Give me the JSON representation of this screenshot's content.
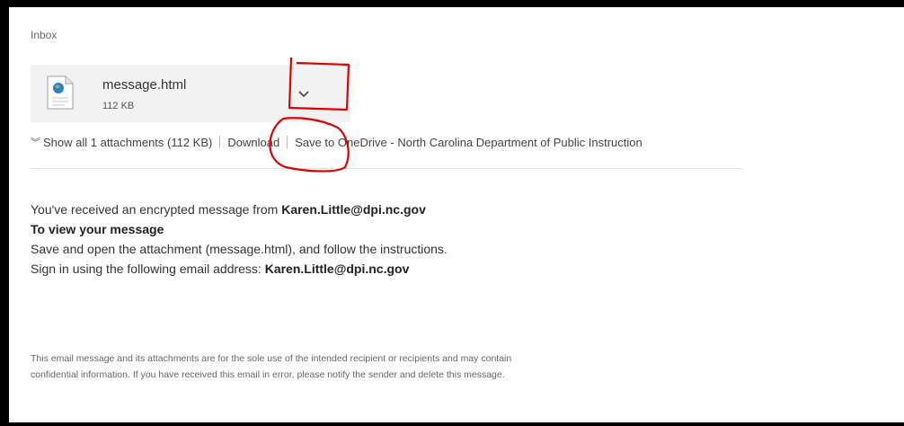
{
  "folder": "Inbox",
  "attachment": {
    "name": "message.html",
    "size": "112 KB",
    "icon": "html-file-icon"
  },
  "actions": {
    "show_all": "Show all 1 attachments (112 KB)",
    "download": "Download",
    "save_onedrive": "Save to OneDrive - North Carolina Department of Public Instruction"
  },
  "message": {
    "intro": "You've received an encrypted message from ",
    "sender": "Karen.Little@dpi.nc.gov",
    "heading": "To view your message",
    "instructions": "Save and open the attachment (message.html), and follow the instructions.",
    "signin_prefix": "Sign in using the following email address: ",
    "signin_email": "Karen.Little@dpi.nc.gov"
  },
  "footer": {
    "line1": "This email message and its attachments are for the sole use of the intended recipient or recipients and may contain",
    "line2": "confidential information. If you have received this email in error, please notify the sender and delete this message."
  },
  "colors": {
    "background": "#000000",
    "panel": "#ffffff",
    "card": "#f2f2f2",
    "annotation": "#e00000"
  }
}
